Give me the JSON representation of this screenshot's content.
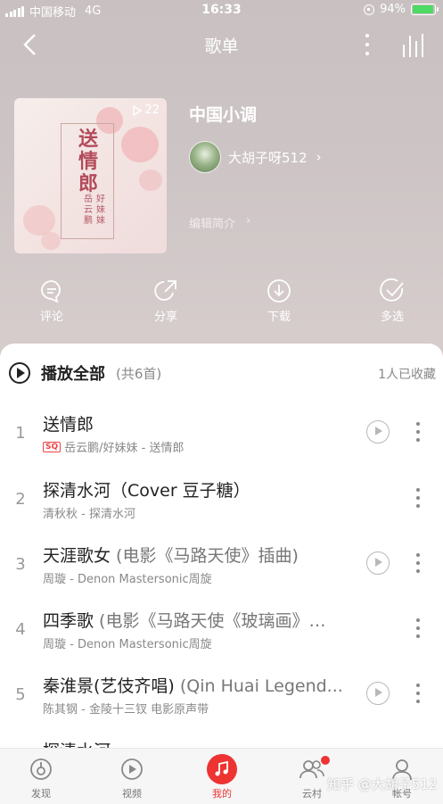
{
  "status": {
    "carrier": "中国移动",
    "network": "4G",
    "time": "16:33",
    "battery": "94%",
    "battery_level": 0.94
  },
  "nav": {
    "title": "歌单"
  },
  "playlist": {
    "title": "中国小调",
    "play_count": "22",
    "creator": "大胡子呀512",
    "edit_intro": "编辑简介",
    "cover_title": "送情郎",
    "cover_artists": [
      "岳云鹏",
      "好妹妹"
    ]
  },
  "actions": [
    {
      "label": "评论",
      "icon": "comment-icon"
    },
    {
      "label": "分享",
      "icon": "share-icon"
    },
    {
      "label": "下载",
      "icon": "download-icon"
    },
    {
      "label": "多选",
      "icon": "check-icon"
    }
  ],
  "list": {
    "play_all": "播放全部",
    "count": "(共6首)",
    "favorites": "1人已收藏"
  },
  "songs": [
    {
      "index": "1",
      "title": "送情郎",
      "extra": "",
      "sq": "SQ",
      "meta": "岳云鹏/好妹妹 - 送情郎",
      "has_play": true
    },
    {
      "index": "2",
      "title": "探清水河（Cover 豆子糖）",
      "extra": "",
      "sq": "",
      "meta": "清秋秋 - 探清水河",
      "has_play": false
    },
    {
      "index": "3",
      "title": "天涯歌女",
      "extra": " (电影《马路天使》插曲)",
      "sq": "",
      "meta": "周璇 - Denon Mastersonic周旋",
      "has_play": true
    },
    {
      "index": "4",
      "title": "四季歌",
      "extra": " (电影《马路天使《玻璃画》…",
      "sq": "",
      "meta": "周璇 - Denon Mastersonic周旋",
      "has_play": false
    },
    {
      "index": "5",
      "title": "秦淮景(艺伎齐唱)",
      "extra": " (Qin Huai Legend...",
      "sq": "",
      "meta": "陈其钢 - 金陵十三钗 电影原声带",
      "has_play": true
    },
    {
      "index": "",
      "title": "探清水河",
      "extra": "",
      "sq": "",
      "meta": "",
      "has_play": false
    }
  ],
  "tabs": [
    {
      "label": "发现",
      "icon": "discover-icon",
      "active": false
    },
    {
      "label": "视频",
      "icon": "video-icon",
      "active": false
    },
    {
      "label": "我的",
      "icon": "music-note-icon",
      "active": true
    },
    {
      "label": "云村",
      "icon": "friends-icon",
      "active": false,
      "badge": true
    },
    {
      "label": "帐号",
      "icon": "account-icon",
      "active": false
    }
  ],
  "watermark": "知乎 @大胡子512",
  "colors": {
    "accent": "#e33333",
    "header_bg": "#c9c1c1"
  }
}
